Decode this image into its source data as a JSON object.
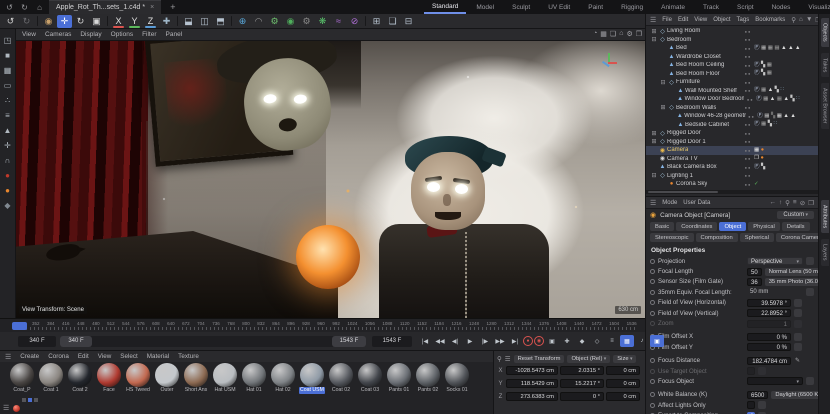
{
  "window": {
    "tab_title": "Apple_Rot_Th...sets_1.c4d *",
    "close": "×",
    "add_tab": "+",
    "icons": [
      {
        "name": "undo-history-icon",
        "g": "↺"
      },
      {
        "name": "redo-history-icon",
        "g": "↻"
      },
      {
        "name": "home-icon",
        "g": "⌂"
      }
    ]
  },
  "layout_tabs": {
    "kebab": "⋮",
    "items": [
      {
        "label": "Standard",
        "cls": "active"
      },
      {
        "label": "Model"
      },
      {
        "label": "Sculpt"
      },
      {
        "label": "UV Edit"
      },
      {
        "label": "Paint"
      },
      {
        "label": "Rigging"
      },
      {
        "label": "Animate"
      },
      {
        "label": "Track"
      },
      {
        "label": "Script"
      },
      {
        "label": "Nodes"
      },
      {
        "label": "Visualize"
      }
    ]
  },
  "toolbar": {
    "icons": [
      {
        "name": "undo-icon",
        "g": "↺",
        "c": "#d0d0d0"
      },
      {
        "name": "redo-icon",
        "g": "↻",
        "c": "#6a6a6e"
      },
      {
        "cls": "sep"
      },
      {
        "name": "live-selection-tool-icon",
        "g": "◉",
        "c": "#c8a06a"
      },
      {
        "name": "move-tool-icon",
        "g": "✛",
        "c": "#ffffff",
        "bg": "#4b6fd6"
      },
      {
        "name": "rotate-tool-icon",
        "g": "↻",
        "c": "#d8d8d8"
      },
      {
        "name": "scale-tool-icon",
        "g": "▣",
        "c": "#d8d8d8"
      },
      {
        "cls": "sep"
      },
      {
        "name": "x-axis-lock-icon",
        "g": "X",
        "c": "#e0e0e0",
        "ul": "#d9534f"
      },
      {
        "name": "y-axis-lock-icon",
        "g": "Y",
        "c": "#e0e0e0",
        "ul": "#5cb85c"
      },
      {
        "name": "z-axis-lock-icon",
        "g": "Z",
        "c": "#e0e0e0",
        "ul": "#5b9bd5"
      },
      {
        "name": "coordinate-system-icon",
        "g": "✚",
        "c": "#9fb6c8"
      },
      {
        "cls": "sep"
      },
      {
        "name": "render-view-icon",
        "g": "⬓",
        "c": "#b7c3d0"
      },
      {
        "name": "render-picture-viewer-icon",
        "g": "◫",
        "c": "#b7c3d0"
      },
      {
        "name": "render-settings-icon",
        "g": "⬒",
        "c": "#b7c3d0"
      },
      {
        "cls": "sep"
      },
      {
        "name": "render-globe-icon",
        "g": "⊕",
        "c": "#58a6d8"
      },
      {
        "name": "interactive-region-icon",
        "g": "◠",
        "c": "#9a9a9a"
      },
      {
        "name": "green-gear-icon",
        "g": "⚙",
        "c": "#6fbf6f"
      },
      {
        "name": "green-sphere-icon",
        "g": "◉",
        "c": "#4fae5c"
      },
      {
        "name": "gear-icon",
        "g": "⚙",
        "c": "#8a8a8a"
      },
      {
        "name": "plugin-icon",
        "g": "❋",
        "c": "#58c06a"
      },
      {
        "name": "spline-icon",
        "g": "≈",
        "c": "#b06fd8"
      },
      {
        "name": "spline-circle-icon",
        "g": "⊘",
        "c": "#b06fd8"
      },
      {
        "cls": "sep"
      },
      {
        "name": "array-icon",
        "g": "⊞",
        "c": "#b7c3d0"
      },
      {
        "name": "extrude-icon",
        "g": "❏",
        "c": "#b7c3d0"
      },
      {
        "name": "layout-icon",
        "g": "⊟",
        "c": "#b7c3d0"
      }
    ]
  },
  "left_strip": {
    "icons": [
      {
        "name": "make-editable-icon",
        "g": "◳",
        "c": "#b0b8c0"
      },
      {
        "name": "model-mode-icon",
        "g": "■",
        "c": "#b0b8c0"
      },
      {
        "name": "texture-mode-icon",
        "g": "▦",
        "c": "#b0b8c0"
      },
      {
        "name": "workplane-mode-icon",
        "g": "▭",
        "c": "#b0b8c0"
      },
      {
        "name": "points-mode-icon",
        "g": "∴",
        "c": "#b0b8c0"
      },
      {
        "name": "edges-mode-icon",
        "g": "≡",
        "c": "#b0b8c0"
      },
      {
        "name": "polygons-mode-icon",
        "g": "▲",
        "c": "#b0b8c0"
      },
      {
        "name": "enable-axis-icon",
        "g": "✛",
        "c": "#b0b8c0"
      },
      {
        "name": "snap-icon",
        "g": "∩",
        "c": "#b0b8c0"
      },
      {
        "name": "record-dot-icon",
        "g": "●",
        "c": "#c0392b"
      },
      {
        "name": "solo-dot-icon",
        "g": "●",
        "c": "#e8862e"
      },
      {
        "name": "misc-tool-icon",
        "g": "◆",
        "c": "#808890"
      }
    ]
  },
  "viewport": {
    "menus": [
      "View",
      "Cameras",
      "Display",
      "Options",
      "Filter",
      "Panel"
    ],
    "right_icons": [
      {
        "name": "camera-view-icon",
        "g": "◔"
      },
      {
        "name": "grid-icon",
        "g": "▦"
      },
      {
        "name": "safe-frames-icon",
        "g": "❏"
      },
      {
        "name": "default-view-icon",
        "g": "⌂"
      },
      {
        "name": "settings-gear-icon",
        "g": "⚙"
      },
      {
        "name": "split-panel-icon",
        "g": "❐"
      }
    ],
    "hud_left": "View Transform: Scene",
    "hud_right": "630 cm"
  },
  "object_manager": {
    "menus": [
      "File",
      "Edit",
      "View",
      "Object",
      "Tags",
      "Bookmarks"
    ],
    "icons": [
      {
        "name": "search-icon",
        "g": "⚲"
      },
      {
        "name": "home-icon",
        "g": "⌂"
      },
      {
        "name": "filter-icon",
        "g": "▼"
      },
      {
        "name": "new-panel-icon",
        "g": "❐"
      }
    ],
    "side_tabs": [
      {
        "label": "Objects",
        "cls": "active"
      },
      {
        "label": "Takes"
      },
      {
        "label": "Asset Browser"
      }
    ],
    "tree": [
      {
        "label": "Living Room",
        "lvl": 0,
        "exp": "⊞",
        "iconG": "◇",
        "iconC": "#9fc0d8",
        "tags": []
      },
      {
        "label": "Bedroom",
        "lvl": 0,
        "exp": "⊟",
        "iconG": "◇",
        "iconC": "#9fc0d8",
        "tags": []
      },
      {
        "label": "Bed",
        "lvl": 1,
        "exp": "",
        "iconG": "▲",
        "iconC": "#86b4e4",
        "tags": [
          {
            "g": "Ⓟ",
            "c": "#b8c4dc"
          },
          {
            "g": "▦",
            "c": "#b9b9b9"
          },
          {
            "g": "▦",
            "c": "#a5a5a5"
          },
          {
            "g": "▦",
            "c": "#8f8f8f"
          },
          {
            "g": "▲",
            "c": "#dcdcdc"
          },
          {
            "g": "▲",
            "c": "#dcdcdc"
          },
          {
            "g": "▲",
            "c": "#dcdcdc"
          }
        ]
      },
      {
        "label": "Wardrobe Closet",
        "lvl": 1,
        "exp": "",
        "iconG": "▲",
        "iconC": "#86b4e4",
        "tags": []
      },
      {
        "label": "Bed Room Ceiling",
        "lvl": 1,
        "exp": "",
        "iconG": "▲",
        "iconC": "#86b4e4",
        "tags": [
          {
            "g": "Ⓟ",
            "c": "#b8c4dc"
          },
          {
            "g": "▚",
            "c": "#c6c6c6"
          },
          {
            "g": "▦",
            "c": "#a5a5a5"
          }
        ]
      },
      {
        "label": "Bed Room Floor",
        "lvl": 1,
        "exp": "",
        "iconG": "▲",
        "iconC": "#86b4e4",
        "tags": [
          {
            "g": "Ⓟ",
            "c": "#b8c4dc"
          },
          {
            "g": "▚",
            "c": "#c6c6c6"
          },
          {
            "g": "▦",
            "c": "#a5a5a5"
          }
        ]
      },
      {
        "label": "Furniture",
        "lvl": 1,
        "exp": "⊟",
        "iconG": "◇",
        "iconC": "#9fc0d8",
        "tags": []
      },
      {
        "label": "Wall Mounted Shelf",
        "lvl": 2,
        "exp": "",
        "iconG": "▲",
        "iconC": "#86b4e4",
        "tags": [
          {
            "g": "Ⓟ",
            "c": "#b8c4dc"
          },
          {
            "g": "▦",
            "c": "#a5a5a5"
          },
          {
            "g": "▲",
            "c": "#dcdcdc"
          },
          {
            "g": "▚",
            "c": "#c6c6c6"
          },
          {
            "g": "∷",
            "c": "#9fc0d8"
          }
        ]
      },
      {
        "label": "Window Door Bedroom",
        "lvl": 2,
        "exp": "",
        "iconG": "▲",
        "iconC": "#86b4e4",
        "tags": [
          {
            "g": "Ⓟ",
            "c": "#b8c4dc"
          },
          {
            "g": "▦",
            "c": "#a5a5a5"
          },
          {
            "g": "▲",
            "c": "#dcdcdc"
          },
          {
            "g": "▦",
            "c": "#8f8f8f"
          },
          {
            "g": "▲",
            "c": "#dcdcdc"
          },
          {
            "g": "▚",
            "c": "#c6c6c6"
          },
          {
            "g": "∷",
            "c": "#9fc0d8"
          }
        ]
      },
      {
        "label": "Bedroom Walls",
        "lvl": 1,
        "exp": "⊞",
        "iconG": "◇",
        "iconC": "#9fc0d8",
        "tags": []
      },
      {
        "label": "Window 46-28 geometry",
        "lvl": 2,
        "exp": "",
        "iconG": "▲",
        "iconC": "#86b4e4",
        "tags": [
          {
            "g": "Ⓟ",
            "c": "#b8c4dc"
          },
          {
            "g": "▦",
            "c": "#b9b9b9"
          },
          {
            "g": "▚",
            "c": "#6e6e6e"
          },
          {
            "g": "▦",
            "c": "#d8d8d8"
          },
          {
            "g": "▲",
            "c": "#dcdcdc"
          },
          {
            "g": "▲",
            "c": "#dcdcdc"
          }
        ]
      },
      {
        "label": "Bedside Cabinet",
        "lvl": 2,
        "exp": "",
        "iconG": "▲",
        "iconC": "#86b4e4",
        "tags": [
          {
            "g": "Ⓟ",
            "c": "#b8c4dc"
          },
          {
            "g": "▦",
            "c": "#a5a5a5"
          },
          {
            "g": "▚",
            "c": "#c6c6c6"
          },
          {
            "g": "∷",
            "c": "#9fc0d8"
          }
        ]
      },
      {
        "label": "Rigged Door",
        "lvl": 0,
        "exp": "⊞",
        "iconG": "◇",
        "iconC": "#9fc0d8",
        "tags": []
      },
      {
        "label": "Rigged Door 1",
        "lvl": 0,
        "exp": "⊞",
        "iconG": "◇",
        "iconC": "#9fc0d8",
        "tags": []
      },
      {
        "label": "Camera",
        "lvl": 0,
        "exp": "",
        "iconG": "◉",
        "iconC": "#e8b84b",
        "cls": "selected",
        "labelC": "#e8c868",
        "tags": [
          {
            "g": "▦",
            "c": "#e8e8e8"
          },
          {
            "g": "●",
            "c": "#e8862e"
          }
        ]
      },
      {
        "label": "Camera TV",
        "lvl": 0,
        "exp": "",
        "iconG": "◉",
        "iconC": "#d8d8d8",
        "tags": [
          {
            "g": "❐",
            "c": "#d8d8d8"
          },
          {
            "g": "●",
            "c": "#e8862e"
          }
        ]
      },
      {
        "label": "Black Camera Box",
        "lvl": 0,
        "exp": "",
        "iconG": "▲",
        "iconC": "#86b4e4",
        "tags": [
          {
            "g": "Ⓟ",
            "c": "#b8c4dc"
          },
          {
            "g": "▚",
            "c": "#c6c6c6"
          }
        ]
      },
      {
        "label": "Lighting 1",
        "lvl": 0,
        "exp": "⊟",
        "iconG": "◇",
        "iconC": "#9fc0d8",
        "tags": []
      },
      {
        "label": "Corona Sky",
        "lvl": 1,
        "exp": "",
        "iconG": "●",
        "iconC": "#e8862e",
        "tags": [
          {
            "g": "✓",
            "c": "#5cb85c"
          }
        ]
      }
    ]
  },
  "attribute_manager": {
    "menus": [
      "Mode",
      "User Data"
    ],
    "icons": [
      {
        "name": "back-icon",
        "g": "←"
      },
      {
        "name": "up-icon",
        "g": "↑"
      },
      {
        "name": "search-icon",
        "g": "⚲"
      },
      {
        "name": "filter-icon",
        "g": "≡"
      },
      {
        "name": "lock-icon",
        "g": "⊘"
      },
      {
        "name": "new-panel-icon",
        "g": "❐"
      }
    ],
    "title": "Camera Object [Camera]",
    "preset": "Custom",
    "tabs_row1": [
      {
        "label": "Basic"
      },
      {
        "label": "Coordinates"
      },
      {
        "label": "Object",
        "cls": "active"
      },
      {
        "label": "Physical"
      },
      {
        "label": "Details"
      }
    ],
    "tabs_row2": [
      {
        "label": "Stereoscopic"
      },
      {
        "label": "Composition"
      },
      {
        "label": "Spherical"
      },
      {
        "label": "Corona Camera"
      }
    ],
    "section": "Object Properties",
    "side_tabs": [
      {
        "label": "Attributes",
        "cls": "active"
      },
      {
        "label": "Layers"
      }
    ],
    "rows": [
      {
        "label": "Projection",
        "value": "Perspective",
        "cls": "dropdown"
      },
      {
        "label": "Focal Length",
        "value": "50",
        "extra": "Normal Lens (50 mm)"
      },
      {
        "label": "Sensor Size (Film Gate)",
        "value": "36",
        "extra": "35 mm Photo (36.0 mm)"
      },
      {
        "label": "35mm Equiv. Focal Length:",
        "value": "50 mm",
        "cls": "static"
      },
      {
        "label": "Field of View (Horizontal)",
        "value": "39.5978 °"
      },
      {
        "label": "Field of View (Vertical)",
        "value": "22.8952 °"
      },
      {
        "label": "Zoom",
        "value": "1",
        "cls": "disabled"
      },
      {
        "label": "Film Offset X",
        "value": "0 %",
        "cls": "gap"
      },
      {
        "label": "Film Offset Y",
        "value": "0 %"
      },
      {
        "label": "Focus Distance",
        "value": "182.4784 cm",
        "extra": "✎",
        "cls": "gap picker"
      },
      {
        "label": "Use Target Object",
        "cls": "check off disabled"
      },
      {
        "label": "Focus Object",
        "value": "",
        "cls": "objfield"
      },
      {
        "label": "White Balance (K)",
        "value": "6500",
        "extra": "Daylight (6500 K)",
        "cls": "gap"
      },
      {
        "label": "Affect Lights Only",
        "cls": "check off"
      },
      {
        "label": "Export to Compositing",
        "value": "✓",
        "cls": "check on"
      }
    ]
  },
  "timeline": {
    "current": "340 F",
    "range_start": "340 F",
    "range_end": "1543 F",
    "end_field": "1543 F",
    "ticks": [
      "352",
      "384",
      "416",
      "448",
      "480",
      "512",
      "544",
      "576",
      "608",
      "640",
      "672",
      "704",
      "736",
      "768",
      "800",
      "832",
      "864",
      "896",
      "928",
      "960",
      "992",
      "1024",
      "1056",
      "1088",
      "1120",
      "1152",
      "1184",
      "1216",
      "1248",
      "1280",
      "1312",
      "1344",
      "1376",
      "1408",
      "1440",
      "1472",
      "1504",
      "1536"
    ],
    "transport": [
      {
        "name": "goto-start-button",
        "g": "|◀"
      },
      {
        "name": "prev-key-button",
        "g": "◀◀"
      },
      {
        "name": "prev-frame-button",
        "g": "◀|"
      },
      {
        "name": "play-button",
        "g": "▶"
      },
      {
        "name": "next-frame-button",
        "g": "|▶"
      },
      {
        "name": "next-key-button",
        "g": "▶▶"
      },
      {
        "name": "goto-end-button",
        "g": "▶|"
      },
      {
        "name": "record-button",
        "g": "●",
        "c": "#d9534f",
        "cls": "ring"
      },
      {
        "name": "autokey-record-button",
        "g": "◉",
        "c": "#d9534f",
        "cls": "ring"
      },
      {
        "name": "keyframe-selection-button",
        "g": "▣",
        "c": "#c0c6cc"
      },
      {
        "name": "add-keyframe-button",
        "g": "✚",
        "c": "#c0c6cc"
      },
      {
        "name": "key-position-button",
        "g": "◆",
        "c": "#c0c6cc"
      },
      {
        "name": "key-scale-button",
        "g": "◇",
        "c": "#c0c6cc"
      },
      {
        "name": "key-rotation-button",
        "g": "≡",
        "c": "#c0c6cc"
      },
      {
        "name": "autokey-toggle-button",
        "g": "▦",
        "c": "#ffffff",
        "bg": "#4b6fd6"
      },
      {
        "name": "sound-button",
        "g": "♪",
        "c": "#c0c6cc"
      },
      {
        "name": "solo-toggle-button",
        "g": "▣",
        "c": "#ffffff",
        "bg": "#4b6fd6"
      }
    ]
  },
  "materials": {
    "menus": [
      "Create",
      "Corona",
      "Edit",
      "View",
      "Select",
      "Material",
      "Texture"
    ],
    "items": [
      {
        "name": "Coat_P",
        "color": "#4a4644"
      },
      {
        "name": "Coat 1",
        "color": "#8a8580"
      },
      {
        "name": "Coat 2",
        "color": "#23262c"
      },
      {
        "name": "Face",
        "color": "#b03a30"
      },
      {
        "name": "HS Tweed",
        "color": "#c2684f"
      },
      {
        "name": "Outer",
        "color": "#c4c8cc"
      },
      {
        "name": "Short Ans",
        "color": "#8d6a52"
      },
      {
        "name": "Hat USM",
        "color": "#b9bdc1"
      },
      {
        "name": "Hat 01",
        "color": "#72767a"
      },
      {
        "name": "Hat 02",
        "color": "#7e8286"
      },
      {
        "name": "Coat USM",
        "color": "#8f9aa6",
        "cls": "selected"
      },
      {
        "name": "Coat 02",
        "color": "#55585e"
      },
      {
        "name": "Coat 03",
        "color": "#43464c"
      },
      {
        "name": "Pants 01",
        "color": "#6a6e74"
      },
      {
        "name": "Pants 02",
        "color": "#5d6166"
      },
      {
        "name": "Socks 01",
        "color": "#515459"
      }
    ],
    "pager": [
      {
        "c": "#55555a"
      },
      {
        "c": "#4b6fd6"
      },
      {
        "c": "#55555a"
      }
    ]
  },
  "coordinates": {
    "reset": "Reset Transform",
    "mode": "Object (Rel)",
    "size_mode": "Size",
    "rows": [
      {
        "axis": "X",
        "pos": "-1028.5473 cm",
        "rot": "2.0315 °",
        "size": "0 cm"
      },
      {
        "axis": "Y",
        "pos": "118.5429 cm",
        "rot": "15.2217 °",
        "size": "0 cm"
      },
      {
        "axis": "Z",
        "pos": "273.6383 cm",
        "rot": "0 °",
        "size": "0 cm"
      }
    ]
  }
}
